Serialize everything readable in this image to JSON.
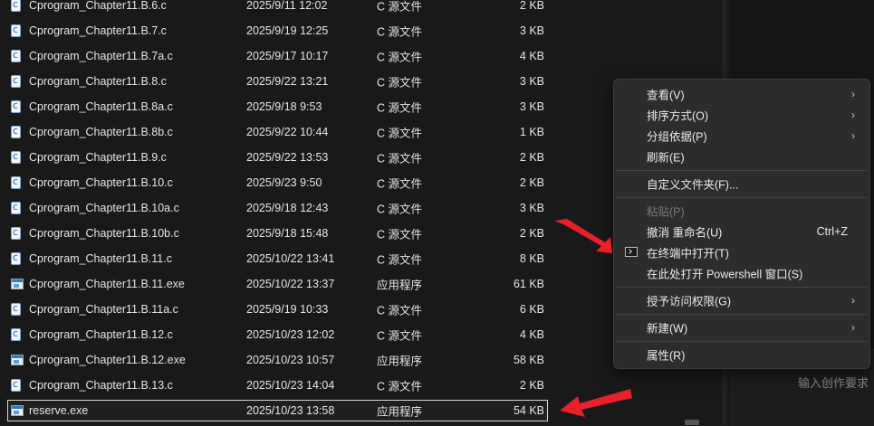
{
  "files": [
    {
      "name": "Cprogram_Chapter11.B.6.c",
      "date": "2025/9/11 12:02",
      "type": "C 源文件",
      "size": "2 KB",
      "icon": "c-source-file-icon"
    },
    {
      "name": "Cprogram_Chapter11.B.7.c",
      "date": "2025/9/19 12:25",
      "type": "C 源文件",
      "size": "3 KB",
      "icon": "c-source-file-icon"
    },
    {
      "name": "Cprogram_Chapter11.B.7a.c",
      "date": "2025/9/17 10:17",
      "type": "C 源文件",
      "size": "4 KB",
      "icon": "c-source-file-icon"
    },
    {
      "name": "Cprogram_Chapter11.B.8.c",
      "date": "2025/9/22 13:21",
      "type": "C 源文件",
      "size": "3 KB",
      "icon": "c-source-file-icon"
    },
    {
      "name": "Cprogram_Chapter11.B.8a.c",
      "date": "2025/9/18 9:53",
      "type": "C 源文件",
      "size": "3 KB",
      "icon": "c-source-file-icon"
    },
    {
      "name": "Cprogram_Chapter11.B.8b.c",
      "date": "2025/9/22 10:44",
      "type": "C 源文件",
      "size": "1 KB",
      "icon": "c-source-file-icon"
    },
    {
      "name": "Cprogram_Chapter11.B.9.c",
      "date": "2025/9/22 13:53",
      "type": "C 源文件",
      "size": "2 KB",
      "icon": "c-source-file-icon"
    },
    {
      "name": "Cprogram_Chapter11.B.10.c",
      "date": "2025/9/23 9:50",
      "type": "C 源文件",
      "size": "2 KB",
      "icon": "c-source-file-icon"
    },
    {
      "name": "Cprogram_Chapter11.B.10a.c",
      "date": "2025/9/18 12:43",
      "type": "C 源文件",
      "size": "3 KB",
      "icon": "c-source-file-icon"
    },
    {
      "name": "Cprogram_Chapter11.B.10b.c",
      "date": "2025/9/18 15:48",
      "type": "C 源文件",
      "size": "2 KB",
      "icon": "c-source-file-icon"
    },
    {
      "name": "Cprogram_Chapter11.B.11.c",
      "date": "2025/10/22 13:41",
      "type": "C 源文件",
      "size": "8 KB",
      "icon": "c-source-file-icon"
    },
    {
      "name": "Cprogram_Chapter11.B.11.exe",
      "date": "2025/10/22 13:37",
      "type": "应用程序",
      "size": "61 KB",
      "icon": "exe-file-icon"
    },
    {
      "name": "Cprogram_Chapter11.B.11a.c",
      "date": "2025/9/19 10:33",
      "type": "C 源文件",
      "size": "6 KB",
      "icon": "c-source-file-icon"
    },
    {
      "name": "Cprogram_Chapter11.B.12.c",
      "date": "2025/10/23 12:02",
      "type": "C 源文件",
      "size": "4 KB",
      "icon": "c-source-file-icon"
    },
    {
      "name": "Cprogram_Chapter11.B.12.exe",
      "date": "2025/10/23 10:57",
      "type": "应用程序",
      "size": "58 KB",
      "icon": "exe-file-icon"
    },
    {
      "name": "Cprogram_Chapter11.B.13.c",
      "date": "2025/10/23 14:04",
      "type": "C 源文件",
      "size": "2 KB",
      "icon": "c-source-file-icon"
    },
    {
      "name": "reserve.exe",
      "date": "2025/10/23 13:58",
      "type": "应用程序",
      "size": "54 KB",
      "icon": "exe-file-icon",
      "selected": true
    }
  ],
  "context_menu": {
    "view": "查看(V)",
    "sort": "排序方式(O)",
    "group": "分组依据(P)",
    "refresh": "刷新(E)",
    "customize": "自定义文件夹(F)...",
    "paste": "粘贴(P)",
    "undo": "撤消 重命名(U)",
    "undo_shortcut": "Ctrl+Z",
    "open_terminal": "在终端中打开(T)",
    "open_powershell": "在此处打开 Powershell 窗口(S)",
    "give_access": "授予访问权限(G)",
    "new": "新建(W)",
    "properties": "属性(R)",
    "chevron": "›"
  },
  "side_panel": {
    "input_placeholder": "输入创作要求"
  },
  "colors": {
    "background": "#191919",
    "menu_background": "#2c2c2c",
    "arrow": "#e8202a"
  }
}
